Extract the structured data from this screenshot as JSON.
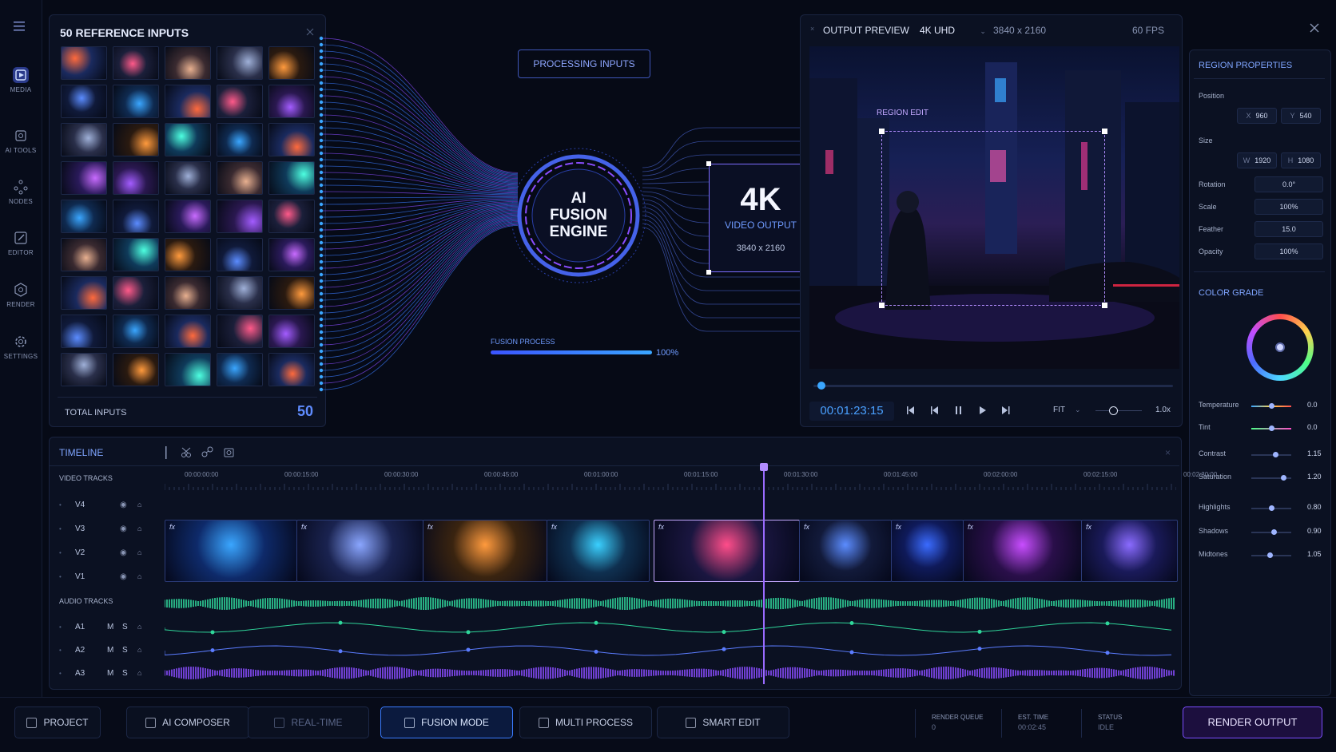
{
  "rail": {
    "items": [
      {
        "label": "MEDIA",
        "icon": "media-icon"
      },
      {
        "label": "AI TOOLS",
        "icon": "ai-tools-icon"
      },
      {
        "label": "NODES",
        "icon": "nodes-icon"
      },
      {
        "label": "EDITOR",
        "icon": "editor-icon"
      },
      {
        "label": "RENDER",
        "icon": "render-icon"
      },
      {
        "label": "SETTINGS",
        "icon": "gear-icon"
      }
    ]
  },
  "inputs_panel": {
    "title": "50 REFERENCE INPUTS",
    "total_label": "TOTAL INPUTS",
    "total_value": "50"
  },
  "fusion": {
    "processing_label": "PROCESSING INPUTS",
    "engine_line1": "AI",
    "engine_line2": "FUSION",
    "engine_line3": "ENGINE",
    "output_big": "4K",
    "output_label": "VIDEO OUTPUT",
    "output_res": "3840 x 2160",
    "progress_label": "FUSION PROCESS",
    "progress_percent": "100%",
    "progress_value": 1.0
  },
  "preview": {
    "title": "OUTPUT PREVIEW",
    "quality": "4K UHD",
    "resolution": "3840 x 2160",
    "fps": "60 FPS",
    "region_label": "REGION EDIT",
    "timecode": "00:01:23:15",
    "fit_label": "FIT",
    "speed": "1.0x"
  },
  "region_properties": {
    "title": "REGION PROPERTIES",
    "position_label": "Position",
    "x_label": "X",
    "x_value": "960",
    "y_label": "Y",
    "y_value": "540",
    "size_label": "Size",
    "w_label": "W",
    "w_value": "1920",
    "h_label": "H",
    "h_value": "1080",
    "rows": [
      {
        "label": "Rotation",
        "value": "0.0°"
      },
      {
        "label": "Scale",
        "value": "100%"
      },
      {
        "label": "Feather",
        "value": "15.0"
      },
      {
        "label": "Opacity",
        "value": "100%"
      }
    ]
  },
  "color_grade": {
    "title": "COLOR GRADE",
    "sliders": [
      {
        "label": "Temperature",
        "value": "0.0",
        "level": 0.5
      },
      {
        "label": "Tint",
        "value": "0.0",
        "level": 0.5
      },
      {
        "label": "Contrast",
        "value": "1.15",
        "level": 0.6
      },
      {
        "label": "Saturation",
        "value": "1.20",
        "level": 0.8
      },
      {
        "label": "Highlights",
        "value": "0.80",
        "level": 0.5
      },
      {
        "label": "Shadows",
        "value": "0.90",
        "level": 0.55
      },
      {
        "label": "Midtones",
        "value": "1.05",
        "level": 0.45
      }
    ]
  },
  "timeline": {
    "title": "TIMELINE",
    "video_tracks_label": "VIDEO TRACKS",
    "audio_tracks_label": "AUDIO TRACKS",
    "video_tracks": [
      "V4",
      "V3",
      "V2",
      "V1"
    ],
    "audio_tracks": [
      "A1",
      "A2",
      "A3"
    ],
    "mute_label": "M",
    "solo_label": "S",
    "ruler": [
      "00:00:00:00",
      "00:00:15:00",
      "00:00:30:00",
      "00:00:45:00",
      "00:01:00:00",
      "00:01:15:00",
      "00:01:30:00",
      "00:01:45:00",
      "00:02:00:00",
      "00:02:15:00",
      "00:02:30:00"
    ],
    "clip_fx_label": "fx"
  },
  "bottom_bar": {
    "buttons": [
      {
        "label": "PROJECT",
        "icon": "folder-icon"
      },
      {
        "label": "AI COMPOSER",
        "icon": "composer-icon"
      },
      {
        "label": "REAL-TIME",
        "icon": "realtime-icon"
      },
      {
        "label": "FUSION MODE",
        "icon": "fusion-icon"
      },
      {
        "label": "MULTI PROCESS",
        "icon": "multi-process-icon"
      },
      {
        "label": "SMART EDIT",
        "icon": "smart-edit-icon"
      }
    ],
    "render_queue_label": "RENDER QUEUE",
    "render_queue_value": "0",
    "est_time_label": "EST. TIME",
    "est_time_value": "00:02:45",
    "status_label": "STATUS",
    "status_value": "IDLE",
    "render_button": "RENDER OUTPUT"
  },
  "colors": {
    "accent": "#3d6cff",
    "purple": "#8a4dff",
    "cyan": "#3aa6ff",
    "green_wave": "#2fd69a",
    "bg": "#060a16"
  }
}
